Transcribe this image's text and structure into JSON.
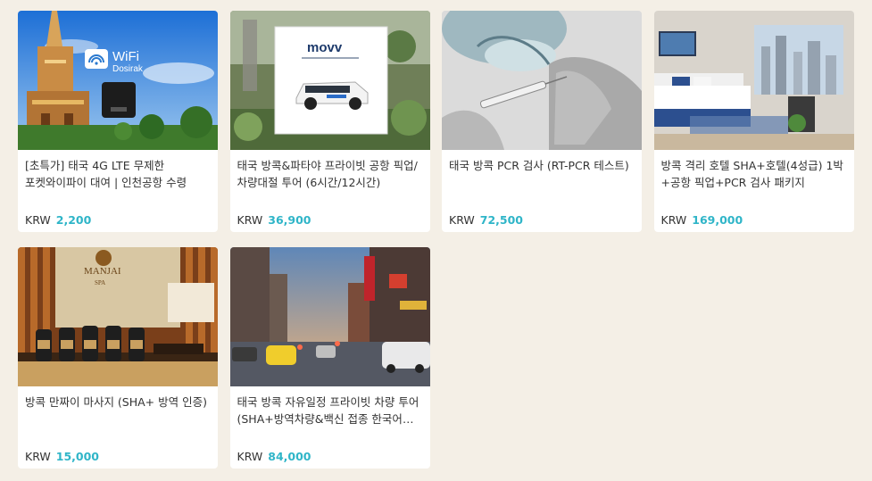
{
  "products": [
    {
      "title": "[초특가] 태국 4G LTE 무제한 포켓와이파이 대여 | 인천공항 수령",
      "currency": "KRW",
      "price": "2,200",
      "image_icon": "wifi-temple-image",
      "badge_line1": "WiFi",
      "badge_line2": "Dosirak"
    },
    {
      "title": "태국 방콕&파타야 프라이빗 공항 픽업/차량대절 투어 (6시간/12시간)",
      "currency": "KRW",
      "price": "36,900",
      "image_icon": "van-poster-image",
      "logo_text": "movv"
    },
    {
      "title": "태국 방콕 PCR 검사 (RT-PCR 테스트)",
      "currency": "KRW",
      "price": "72,500",
      "image_icon": "syringe-image"
    },
    {
      "title": "방콕 격리 호텔 SHA+호텔(4성급) 1박+공항 픽업+PCR 검사 패키지",
      "currency": "KRW",
      "price": "169,000",
      "image_icon": "hotel-room-image"
    },
    {
      "title": "방콕 만짜이 마사지 (SHA+ 방역 인증)",
      "currency": "KRW",
      "price": "15,000",
      "image_icon": "spa-products-image",
      "sign_line1": "MANJAI",
      "sign_line2": "SPA"
    },
    {
      "title": "태국 방콕 자유일정 프라이빗 차량 투어 (SHA+방역차량&백신 접종 한국어 가이드)",
      "currency": "KRW",
      "price": "84,000",
      "image_icon": "city-street-image"
    }
  ],
  "colors": {
    "background": "#f4efe6",
    "price_accent": "#2fb5c8",
    "text": "#333333"
  }
}
